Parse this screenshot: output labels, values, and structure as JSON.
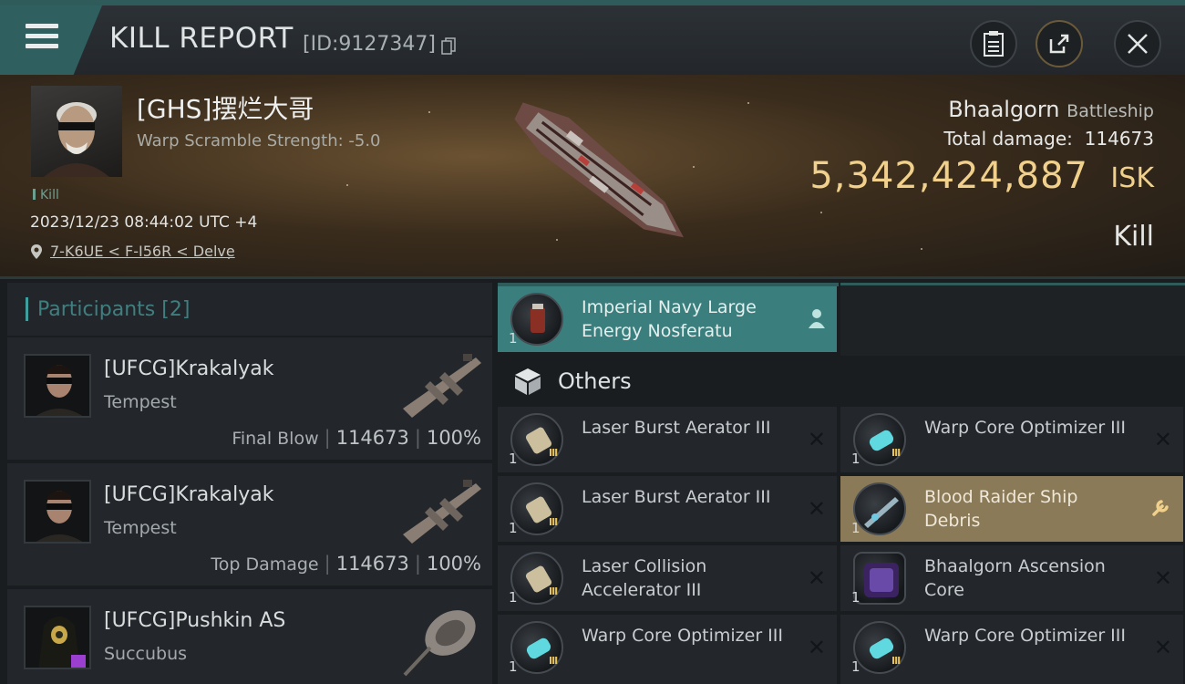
{
  "header": {
    "title": "KILL REPORT",
    "report_id": "[ID:9127347]"
  },
  "victim": {
    "pilot_name": "[GHS]摆烂大哥",
    "warp_scramble": "Warp Scramble Strength: -5.0",
    "kill_tag": "Kill",
    "datetime": "2023/12/23 08:44:02 UTC +4",
    "location": "7-K6UE < F-I56R < Delve",
    "ship_name": "Bhaalgorn",
    "ship_class": "Battleship",
    "total_damage_label": "Total damage:",
    "total_damage": "114673",
    "isk_value": "5,342,424,887",
    "isk_unit": "ISK",
    "status": "Kill"
  },
  "participants": {
    "title": "Participants",
    "count": "[2]",
    "rows": [
      {
        "name": "[UFCG]Krakalyak",
        "ship": "Tempest",
        "label": "Final Blow",
        "damage": "114673",
        "percent": "100%"
      },
      {
        "name": "[UFCG]Krakalyak",
        "ship": "Tempest",
        "label": "Top Damage",
        "damage": "114673",
        "percent": "100%"
      },
      {
        "name": "[UFCG]Pushkin AS",
        "ship": "Succubus"
      }
    ]
  },
  "items": {
    "featured": {
      "name": "Imperial Navy Large Energy Nosferatu",
      "qty": "1",
      "icon": "person-icon"
    },
    "others_label": "Others",
    "others": [
      {
        "name": "Laser Burst Aerator III",
        "qty": "1",
        "tier": "III"
      },
      {
        "name": "Warp Core Optimizer III",
        "qty": "1",
        "tier": "III"
      },
      {
        "name": "Laser Burst Aerator III",
        "qty": "1",
        "tier": "III"
      },
      {
        "name": "Blood Raider Ship Debris",
        "qty": "1",
        "icon": "wrench-icon"
      },
      {
        "name": "Laser Collision Accelerator III",
        "qty": "1",
        "tier": "III"
      },
      {
        "name": "Bhaalgorn Ascension Core",
        "qty": "1"
      },
      {
        "name": "Warp Core Optimizer III",
        "qty": "1",
        "tier": "III"
      },
      {
        "name": "Warp Core Optimizer III",
        "qty": "1",
        "tier": "III"
      }
    ]
  },
  "colors": {
    "accent_teal": "#3a7f7e",
    "isk_gold": "#f0d08a",
    "highlight_gold": "#8a7a57"
  }
}
